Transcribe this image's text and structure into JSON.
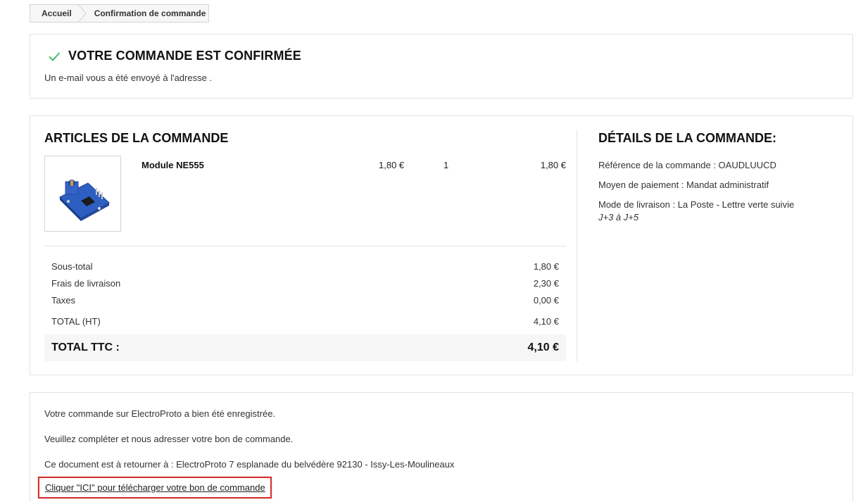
{
  "breadcrumb": {
    "home": "Accueil",
    "current": "Confirmation de commande"
  },
  "confirmation": {
    "title": "VOTRE COMMANDE EST CONFIRMÉE",
    "email_text": "Un e-mail vous a été envoyé à l'adresse .",
    "check_color": "#4cbb6c"
  },
  "order_items": {
    "title": "ARTICLES DE LA COMMANDE",
    "items": [
      {
        "name": "Module NE555",
        "unit_price": "1,80 €",
        "quantity": "1",
        "total": "1,80 €",
        "image_icon": "ne555-module-image"
      }
    ],
    "summary": [
      {
        "label": "Sous-total",
        "value": "1,80 €"
      },
      {
        "label": "Frais de livraison",
        "value": "2,30 €"
      },
      {
        "label": "Taxes",
        "value": "0,00 €"
      },
      {
        "label": "TOTAL (HT)",
        "value": "4,10 €"
      }
    ],
    "total_ttc": {
      "label": "TOTAL TTC :",
      "value": "4,10 €"
    }
  },
  "order_details": {
    "title": "DÉTAILS DE LA COMMANDE:",
    "reference": "Référence de la commande : OAUDLUUCD",
    "payment_method": "Moyen de paiement : Mandat administratif",
    "shipping_method": "Mode de livraison : La Poste - Lettre verte suivie",
    "shipping_delay": "J+3 à J+5"
  },
  "payment_info": {
    "line1": "Votre commande sur ElectroProto a bien été enregistrée.",
    "line2": "Veuillez compléter et nous adresser votre bon de commande.",
    "line3": "Ce document est à retourner à : ElectroProto 7 esplanade du belvédère 92130 - Issy-Les-Moulineaux",
    "download_link": "Cliquer \"ICI\" pour télécharger votre bon de commande",
    "highlight_color": "#d32f2f"
  }
}
